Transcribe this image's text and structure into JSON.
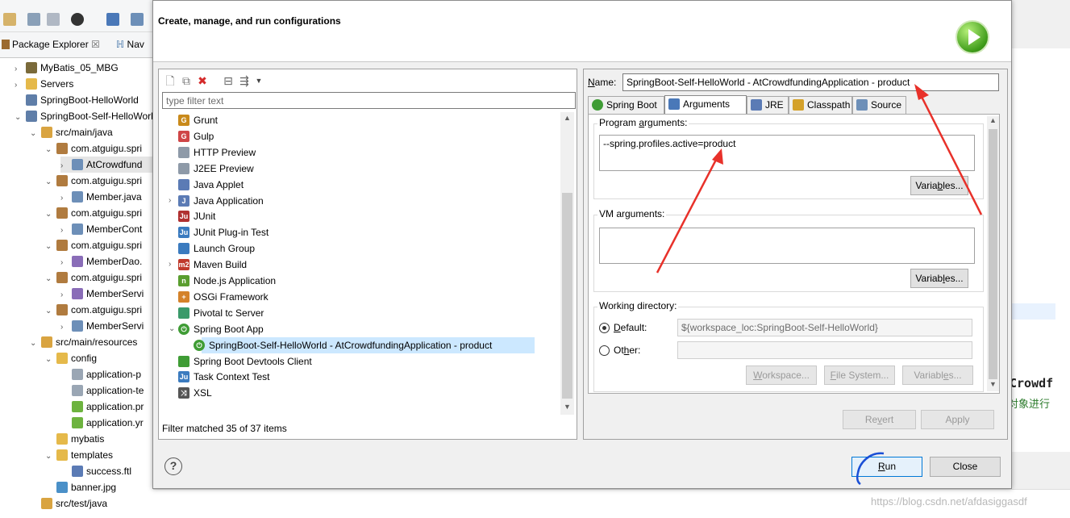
{
  "package_explorer": {
    "tab_label": "Package Explorer",
    "nav_tab_label": "Nav",
    "tree": [
      {
        "label": "MyBatis_05_MBG",
        "indent": 0,
        "twisty": ">",
        "icon": "project-icon",
        "color": "#7a6a3a"
      },
      {
        "label": "Servers",
        "indent": 0,
        "twisty": ">",
        "icon": "folder-icon",
        "color": "#e5b94a"
      },
      {
        "label": "SpringBoot-HelloWorld",
        "indent": 0,
        "twisty": "",
        "icon": "project-icon",
        "color": "#5f7ea8"
      },
      {
        "label": "SpringBoot-Self-HelloWorld",
        "indent": 0,
        "twisty": "v",
        "icon": "maven-project-icon",
        "color": "#5f7ea8"
      },
      {
        "label": "src/main/java",
        "indent": 1,
        "twisty": "v",
        "icon": "source-folder-icon",
        "color": "#d9a441"
      },
      {
        "label": "com.atguigu.spri",
        "indent": 2,
        "twisty": "v",
        "icon": "package-icon",
        "color": "#b07b3f"
      },
      {
        "label": "AtCrowdfund",
        "indent": 3,
        "twisty": ">",
        "icon": "java-file-icon",
        "color": "#6d8fb8",
        "selected": true
      },
      {
        "label": "com.atguigu.spri",
        "indent": 2,
        "twisty": "v",
        "icon": "package-icon",
        "color": "#b07b3f"
      },
      {
        "label": "Member.java",
        "indent": 3,
        "twisty": ">",
        "icon": "java-file-icon",
        "color": "#6d8fb8"
      },
      {
        "label": "com.atguigu.spri",
        "indent": 2,
        "twisty": "v",
        "icon": "package-icon",
        "color": "#b07b3f"
      },
      {
        "label": "MemberCont",
        "indent": 3,
        "twisty": ">",
        "icon": "java-file-icon",
        "color": "#6d8fb8"
      },
      {
        "label": "com.atguigu.spri",
        "indent": 2,
        "twisty": "v",
        "icon": "package-icon",
        "color": "#b07b3f"
      },
      {
        "label": "MemberDao.",
        "indent": 3,
        "twisty": ">",
        "icon": "java-interface-icon",
        "color": "#8a6db8"
      },
      {
        "label": "com.atguigu.spri",
        "indent": 2,
        "twisty": "v",
        "icon": "package-icon",
        "color": "#b07b3f"
      },
      {
        "label": "MemberServi",
        "indent": 3,
        "twisty": ">",
        "icon": "java-interface-icon",
        "color": "#8a6db8"
      },
      {
        "label": "com.atguigu.spri",
        "indent": 2,
        "twisty": "v",
        "icon": "package-icon",
        "color": "#b07b3f"
      },
      {
        "label": "MemberServi",
        "indent": 3,
        "twisty": ">",
        "icon": "java-file-icon",
        "color": "#6d8fb8"
      },
      {
        "label": "src/main/resources",
        "indent": 1,
        "twisty": "v",
        "icon": "source-folder-icon",
        "color": "#d9a441"
      },
      {
        "label": "config",
        "indent": 2,
        "twisty": "v",
        "icon": "folder-icon",
        "color": "#e5b94a"
      },
      {
        "label": "application-p",
        "indent": 3,
        "twisty": "",
        "icon": "text-file-icon",
        "color": "#9aa6b4"
      },
      {
        "label": "application-te",
        "indent": 3,
        "twisty": "",
        "icon": "text-file-icon",
        "color": "#9aa6b4"
      },
      {
        "label": "application.pr",
        "indent": 3,
        "twisty": "",
        "icon": "spring-leaf-icon",
        "color": "#6db33f"
      },
      {
        "label": "application.yr",
        "indent": 3,
        "twisty": "",
        "icon": "spring-yaml-icon",
        "color": "#6db33f"
      },
      {
        "label": "mybatis",
        "indent": 2,
        "twisty": "",
        "icon": "folder-icon",
        "color": "#e5b94a"
      },
      {
        "label": "templates",
        "indent": 2,
        "twisty": "v",
        "icon": "folder-icon",
        "color": "#e5b94a"
      },
      {
        "label": "success.ftl",
        "indent": 3,
        "twisty": "",
        "icon": "ftl-file-icon",
        "color": "#5b7bb5"
      },
      {
        "label": "banner.jpg",
        "indent": 2,
        "twisty": "",
        "icon": "image-file-icon",
        "color": "#4a90c8"
      },
      {
        "label": "src/test/java",
        "indent": 1,
        "twisty": "",
        "icon": "source-folder-icon",
        "color": "#d9a441"
      }
    ]
  },
  "background_editor": {
    "text_line1": "Crowdf",
    "text_line2": "对象进行"
  },
  "dialog": {
    "title": "Create, manage, and run configurations",
    "filter_placeholder": "type filter text",
    "filter_status": "Filter matched 35 of 37 items",
    "config_types": [
      {
        "label": "Grunt",
        "indent": 0,
        "twisty": "",
        "icon": "grunt-icon",
        "color": "#c98a1b",
        "glyph": "G"
      },
      {
        "label": "Gulp",
        "indent": 0,
        "twisty": "",
        "icon": "gulp-icon",
        "color": "#cf4647",
        "glyph": "G"
      },
      {
        "label": "HTTP Preview",
        "indent": 0,
        "twisty": "",
        "icon": "http-preview-icon",
        "color": "#8e9aa8",
        "glyph": ""
      },
      {
        "label": "J2EE Preview",
        "indent": 0,
        "twisty": "",
        "icon": "j2ee-preview-icon",
        "color": "#8e9aa8",
        "glyph": ""
      },
      {
        "label": "Java Applet",
        "indent": 0,
        "twisty": "",
        "icon": "java-applet-icon",
        "color": "#5b7bb5",
        "glyph": ""
      },
      {
        "label": "Java Application",
        "indent": 0,
        "twisty": ">",
        "icon": "java-application-icon",
        "color": "#5b7bb5",
        "glyph": "J"
      },
      {
        "label": "JUnit",
        "indent": 0,
        "twisty": "",
        "icon": "junit-icon",
        "color": "#b03030",
        "glyph": "Ju"
      },
      {
        "label": "JUnit Plug-in Test",
        "indent": 0,
        "twisty": "",
        "icon": "junit-plugin-icon",
        "color": "#3b7bbf",
        "glyph": "Ju"
      },
      {
        "label": "Launch Group",
        "indent": 0,
        "twisty": "",
        "icon": "launch-group-icon",
        "color": "#3b7bbf",
        "glyph": ""
      },
      {
        "label": "Maven Build",
        "indent": 0,
        "twisty": ">",
        "icon": "maven-icon",
        "color": "#c0392b",
        "glyph": "m2"
      },
      {
        "label": "Node.js Application",
        "indent": 0,
        "twisty": "",
        "icon": "nodejs-icon",
        "color": "#5a9e2f",
        "glyph": "n"
      },
      {
        "label": "OSGi Framework",
        "indent": 0,
        "twisty": "",
        "icon": "osgi-icon",
        "color": "#d4822a",
        "glyph": "+"
      },
      {
        "label": "Pivotal tc Server",
        "indent": 0,
        "twisty": "",
        "icon": "pivotal-icon",
        "color": "#3a9a6a",
        "glyph": ""
      },
      {
        "label": "Spring Boot App",
        "indent": 0,
        "twisty": "v",
        "icon": "spring-boot-icon",
        "color": "#3f9c35",
        "glyph": "⏻"
      },
      {
        "label": "SpringBoot-Self-HelloWorld - AtCrowdfundingApplication - product",
        "indent": 1,
        "twisty": "",
        "icon": "spring-boot-icon",
        "color": "#3f9c35",
        "glyph": "⏻",
        "selected": true
      },
      {
        "label": "Spring Boot Devtools Client",
        "indent": 0,
        "twisty": "",
        "icon": "devtools-icon",
        "color": "#3f9c35",
        "glyph": ""
      },
      {
        "label": "Task Context Test",
        "indent": 0,
        "twisty": "",
        "icon": "task-context-icon",
        "color": "#3b7bbf",
        "glyph": "Ju"
      },
      {
        "label": "XSL",
        "indent": 0,
        "twisty": "",
        "icon": "xsl-icon",
        "color": "#555555",
        "glyph": "⤨"
      }
    ],
    "name_label": "Name:",
    "name_value": "SpringBoot-Self-HelloWorld - AtCrowdfundingApplication - product",
    "tabs": [
      {
        "label": "Spring Boot",
        "icon": "spring-boot-icon",
        "active": false
      },
      {
        "label": "Arguments",
        "icon": "arguments-icon",
        "active": true
      },
      {
        "label": "JRE",
        "icon": "jre-icon",
        "active": false
      },
      {
        "label": "Classpath",
        "icon": "classpath-icon",
        "active": false
      },
      {
        "label": "Source",
        "icon": "source-icon",
        "active": false
      }
    ],
    "program_args_label": "Program arguments:",
    "program_args_value": "--spring.profiles.active=product",
    "vm_args_label": "VM arguments:",
    "vm_args_value": "",
    "variables_label": "Variables...",
    "working_dir_label": "Working directory:",
    "default_label": "Default:",
    "default_value": "${workspace_loc:SpringBoot-Self-HelloWorld}",
    "other_label": "Other:",
    "workspace_btn": "Workspace...",
    "filesystem_btn": "File System...",
    "variables_btn2": "Variables...",
    "revert_btn": "Revert",
    "apply_btn": "Apply",
    "run_btn": "Run",
    "close_btn": "Close"
  },
  "watermark": "https://blog.csdn.net/afdasiggasdf",
  "colors": {
    "selection": "#cce8ff",
    "accent": "#0078d7",
    "annotation_red": "#e8312a",
    "annotation_blue": "#1a4fd6"
  }
}
